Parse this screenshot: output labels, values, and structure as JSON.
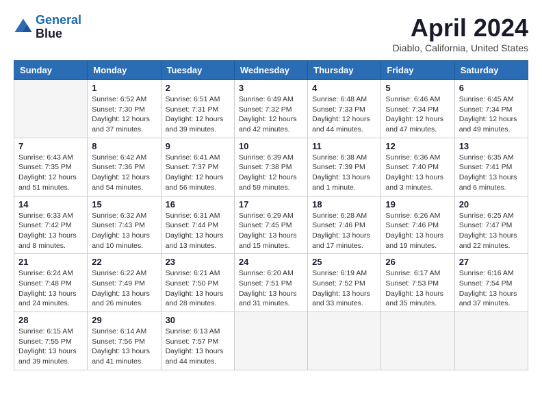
{
  "header": {
    "logo_line1": "General",
    "logo_line2": "Blue",
    "month_title": "April 2024",
    "location": "Diablo, California, United States"
  },
  "weekdays": [
    "Sunday",
    "Monday",
    "Tuesday",
    "Wednesday",
    "Thursday",
    "Friday",
    "Saturday"
  ],
  "weeks": [
    [
      {
        "day": "",
        "info": ""
      },
      {
        "day": "1",
        "info": "Sunrise: 6:52 AM\nSunset: 7:30 PM\nDaylight: 12 hours\nand 37 minutes."
      },
      {
        "day": "2",
        "info": "Sunrise: 6:51 AM\nSunset: 7:31 PM\nDaylight: 12 hours\nand 39 minutes."
      },
      {
        "day": "3",
        "info": "Sunrise: 6:49 AM\nSunset: 7:32 PM\nDaylight: 12 hours\nand 42 minutes."
      },
      {
        "day": "4",
        "info": "Sunrise: 6:48 AM\nSunset: 7:33 PM\nDaylight: 12 hours\nand 44 minutes."
      },
      {
        "day": "5",
        "info": "Sunrise: 6:46 AM\nSunset: 7:34 PM\nDaylight: 12 hours\nand 47 minutes."
      },
      {
        "day": "6",
        "info": "Sunrise: 6:45 AM\nSunset: 7:34 PM\nDaylight: 12 hours\nand 49 minutes."
      }
    ],
    [
      {
        "day": "7",
        "info": "Sunrise: 6:43 AM\nSunset: 7:35 PM\nDaylight: 12 hours\nand 51 minutes."
      },
      {
        "day": "8",
        "info": "Sunrise: 6:42 AM\nSunset: 7:36 PM\nDaylight: 12 hours\nand 54 minutes."
      },
      {
        "day": "9",
        "info": "Sunrise: 6:41 AM\nSunset: 7:37 PM\nDaylight: 12 hours\nand 56 minutes."
      },
      {
        "day": "10",
        "info": "Sunrise: 6:39 AM\nSunset: 7:38 PM\nDaylight: 12 hours\nand 59 minutes."
      },
      {
        "day": "11",
        "info": "Sunrise: 6:38 AM\nSunset: 7:39 PM\nDaylight: 13 hours\nand 1 minute."
      },
      {
        "day": "12",
        "info": "Sunrise: 6:36 AM\nSunset: 7:40 PM\nDaylight: 13 hours\nand 3 minutes."
      },
      {
        "day": "13",
        "info": "Sunrise: 6:35 AM\nSunset: 7:41 PM\nDaylight: 13 hours\nand 6 minutes."
      }
    ],
    [
      {
        "day": "14",
        "info": "Sunrise: 6:33 AM\nSunset: 7:42 PM\nDaylight: 13 hours\nand 8 minutes."
      },
      {
        "day": "15",
        "info": "Sunrise: 6:32 AM\nSunset: 7:43 PM\nDaylight: 13 hours\nand 10 minutes."
      },
      {
        "day": "16",
        "info": "Sunrise: 6:31 AM\nSunset: 7:44 PM\nDaylight: 13 hours\nand 13 minutes."
      },
      {
        "day": "17",
        "info": "Sunrise: 6:29 AM\nSunset: 7:45 PM\nDaylight: 13 hours\nand 15 minutes."
      },
      {
        "day": "18",
        "info": "Sunrise: 6:28 AM\nSunset: 7:46 PM\nDaylight: 13 hours\nand 17 minutes."
      },
      {
        "day": "19",
        "info": "Sunrise: 6:26 AM\nSunset: 7:46 PM\nDaylight: 13 hours\nand 19 minutes."
      },
      {
        "day": "20",
        "info": "Sunrise: 6:25 AM\nSunset: 7:47 PM\nDaylight: 13 hours\nand 22 minutes."
      }
    ],
    [
      {
        "day": "21",
        "info": "Sunrise: 6:24 AM\nSunset: 7:48 PM\nDaylight: 13 hours\nand 24 minutes."
      },
      {
        "day": "22",
        "info": "Sunrise: 6:22 AM\nSunset: 7:49 PM\nDaylight: 13 hours\nand 26 minutes."
      },
      {
        "day": "23",
        "info": "Sunrise: 6:21 AM\nSunset: 7:50 PM\nDaylight: 13 hours\nand 28 minutes."
      },
      {
        "day": "24",
        "info": "Sunrise: 6:20 AM\nSunset: 7:51 PM\nDaylight: 13 hours\nand 31 minutes."
      },
      {
        "day": "25",
        "info": "Sunrise: 6:19 AM\nSunset: 7:52 PM\nDaylight: 13 hours\nand 33 minutes."
      },
      {
        "day": "26",
        "info": "Sunrise: 6:17 AM\nSunset: 7:53 PM\nDaylight: 13 hours\nand 35 minutes."
      },
      {
        "day": "27",
        "info": "Sunrise: 6:16 AM\nSunset: 7:54 PM\nDaylight: 13 hours\nand 37 minutes."
      }
    ],
    [
      {
        "day": "28",
        "info": "Sunrise: 6:15 AM\nSunset: 7:55 PM\nDaylight: 13 hours\nand 39 minutes."
      },
      {
        "day": "29",
        "info": "Sunrise: 6:14 AM\nSunset: 7:56 PM\nDaylight: 13 hours\nand 41 minutes."
      },
      {
        "day": "30",
        "info": "Sunrise: 6:13 AM\nSunset: 7:57 PM\nDaylight: 13 hours\nand 44 minutes."
      },
      {
        "day": "",
        "info": ""
      },
      {
        "day": "",
        "info": ""
      },
      {
        "day": "",
        "info": ""
      },
      {
        "day": "",
        "info": ""
      }
    ]
  ]
}
